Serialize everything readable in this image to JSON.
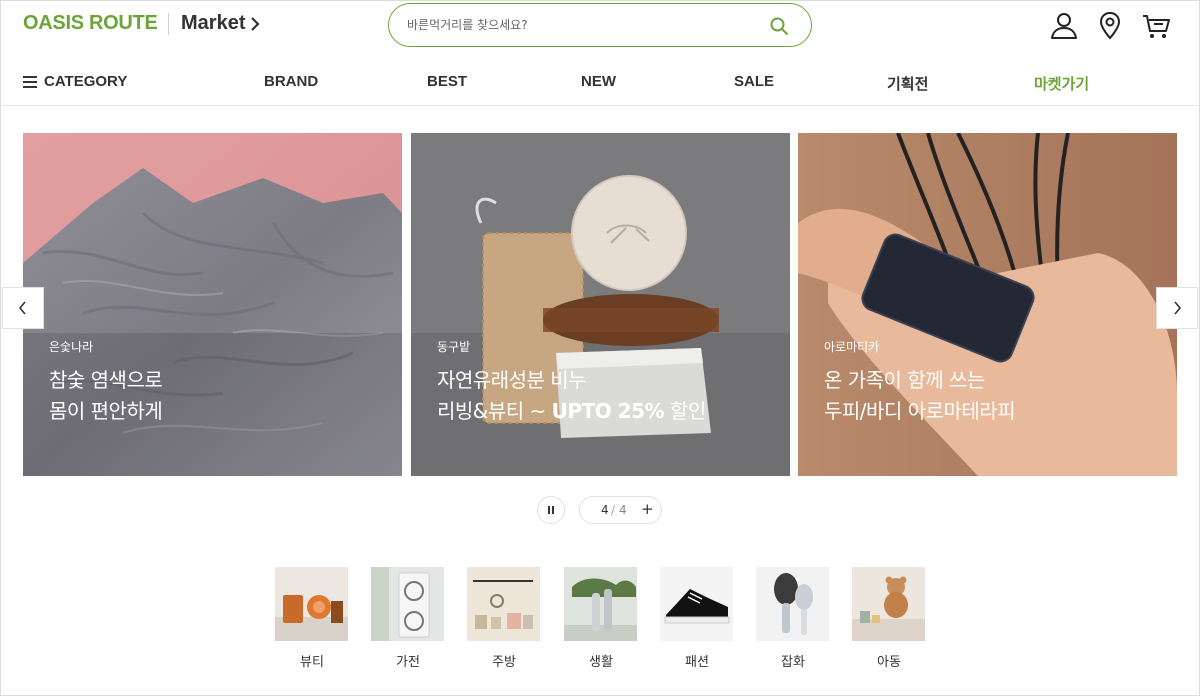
{
  "header": {
    "logo": "OASIS ROUTE",
    "market_label": "Market",
    "search_placeholder": "바른먹거리를 찾으세요?"
  },
  "nav": {
    "category_label": "CATEGORY",
    "items": [
      "BRAND",
      "BEST",
      "NEW",
      "SALE",
      "기획전",
      "마켓가기"
    ],
    "accent_color": "#6ba539"
  },
  "slides": [
    {
      "brand": "은숯나라",
      "line1": "참숯 염색으로",
      "line2": "몸이 편안하게"
    },
    {
      "brand": "동구밭",
      "line1": "자연유래성분 비누",
      "line2_prefix": "리빙&뷰티 ~ ",
      "line2_bold": "UPTO 25%",
      "line2_suffix": " 할인"
    },
    {
      "brand": "아로마티카",
      "line1": "온 가족이 함께 쓰는",
      "line2": "두피/바디 아로마테라피"
    }
  ],
  "pager": {
    "current": "4",
    "separator": "/",
    "total": "4"
  },
  "categories": [
    "뷰티",
    "가전",
    "주방",
    "생활",
    "패션",
    "잡화",
    "아동"
  ],
  "icons": [
    "search-icon",
    "user-icon",
    "location-pin-icon",
    "cart-icon",
    "chevron-right-icon",
    "menu-icon",
    "chevron-left-icon",
    "pause-icon",
    "plus-icon"
  ]
}
